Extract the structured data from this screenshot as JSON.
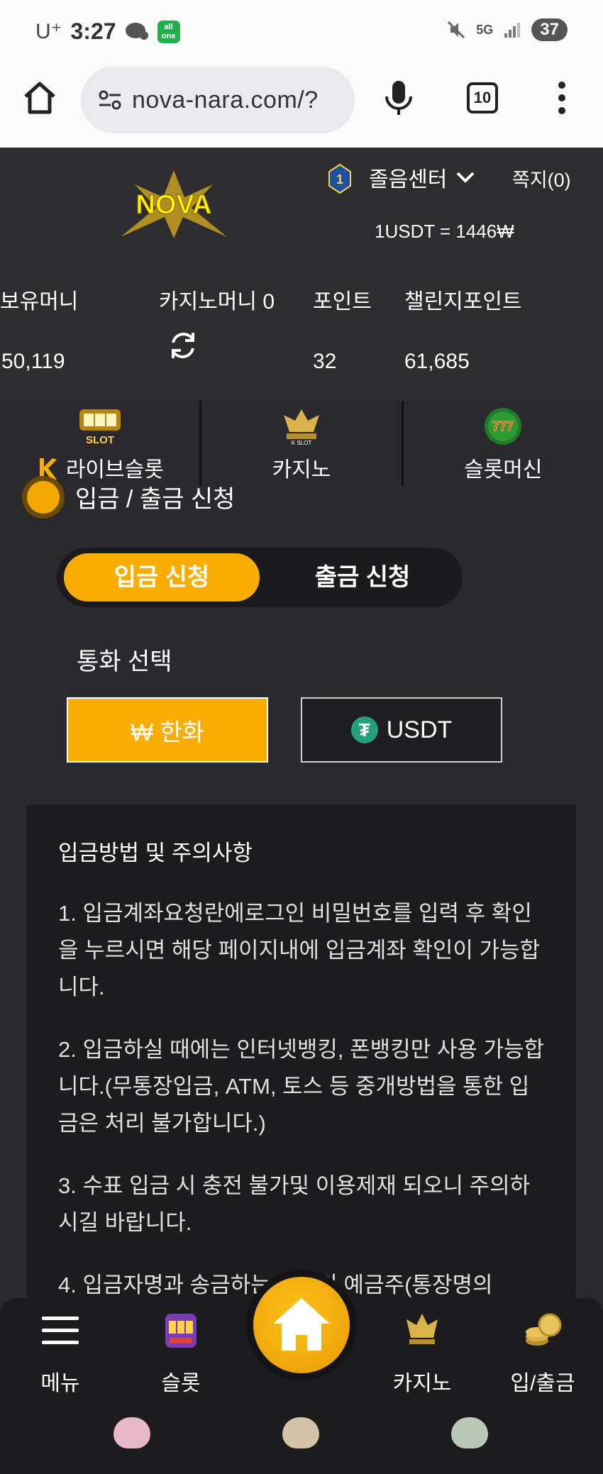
{
  "status_bar": {
    "carrier": "U⁺",
    "time": "3:27",
    "app_badge_lines": [
      "all",
      "one"
    ],
    "network": "5G",
    "battery": "37"
  },
  "browser": {
    "url": "nova-nara.com/?",
    "tab_count": "10"
  },
  "site_header": {
    "logo_text": "NOVA",
    "rank_badge": "1",
    "center_menu": "졸음센터",
    "message": "쪽지(0)",
    "rate": "1USDT = 1446₩"
  },
  "balances": {
    "items": [
      {
        "label": "보유머니",
        "value": "50,119"
      },
      {
        "label": "카지노머니 0",
        "value": ""
      },
      {
        "label": "포인트",
        "value": "32"
      },
      {
        "label": "챌린지포인트",
        "value": "61,685"
      }
    ]
  },
  "categories": [
    {
      "label": "라이브슬롯",
      "icon": "live-slot-icon",
      "icon_text": "SLOT"
    },
    {
      "label": "카지노",
      "icon": "k-slot-crown-icon",
      "icon_text": "K SLOT"
    },
    {
      "label": "슬롯머신",
      "icon": "777-slots-icon",
      "icon_text": "777"
    }
  ],
  "section": {
    "title": "입금 / 출금 신청"
  },
  "toggle": {
    "active": "입금 신청",
    "inactive": "출금 신청"
  },
  "currency": {
    "label": "통화 선택",
    "krw": "₩ 한화",
    "usdt": "USDT",
    "tether_symbol": "₮"
  },
  "notice": {
    "title": "입금방법 및 주의사항",
    "items": [
      "1. 입금계좌요청란에로그인 비밀번호를 입력 후 확인을 누르시면 해당 페이지내에 입금계좌 확인이 가능합니다.",
      "2. 입금하실 때에는 인터넷뱅킹, 폰뱅킹만 사용 가능합니다.(무통장입금, ATM, 토스 등 중개방법을 통한 입금은 처리 불가합니다.)",
      "3. 수표 입금 시 충전 불가및 이용제재 되오니 주의하시길 바랍니다.",
      "4. 입금자명과 송금하는 통장의 예금주(통장명의"
    ]
  },
  "bottom_nav": {
    "items": [
      {
        "label": "메뉴"
      },
      {
        "label": "슬롯"
      },
      {
        "label": "카지노"
      },
      {
        "label": "입/출금"
      }
    ]
  },
  "colors": {
    "accent": "#f8ad00",
    "background": "#2a2a2e",
    "panel": "#1c1c1f",
    "header": "#2d2d30"
  }
}
